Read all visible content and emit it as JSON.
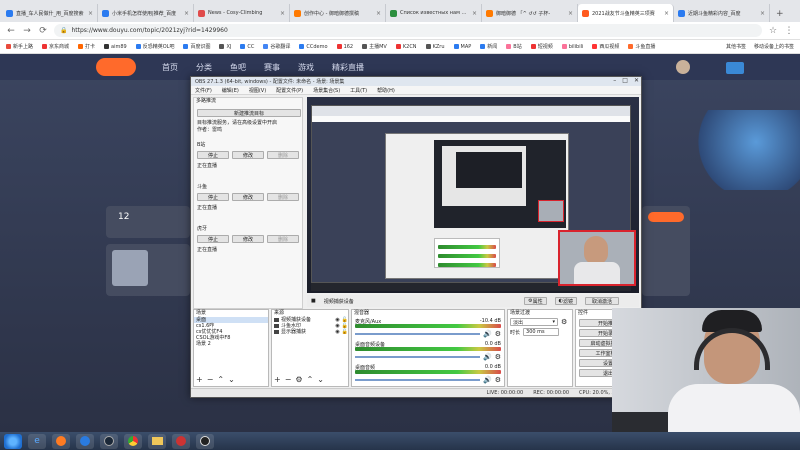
{
  "browser": {
    "tabs": [
      {
        "label": "直播_车人民做什_用_百度搜索",
        "fav": "#2b7bf0"
      },
      {
        "label": "小米手机怎样使用|推荐_百度",
        "fav": "#2b7bf0"
      },
      {
        "label": "News - Cosy-Climbing",
        "fav": "#e04b4b"
      },
      {
        "label": "创作中心 - 御暗御德撰稿",
        "fav": "#ff7a00"
      },
      {
        "label": "Список известных нам карт",
        "fav": "#2c8f3f"
      },
      {
        "label": "御暗御德 「^ ↺↺ 子杯-",
        "fav": "#ff7a00"
      },
      {
        "label": "2021战友节斗鱼精英三项赛",
        "fav": "#ff5a1f",
        "active": true
      },
      {
        "label": "近期斗鱼精彩内容_百度",
        "fav": "#2b7bf0"
      }
    ],
    "url": "https://www.douyu.com/topic/2021zyj?rid=1429960",
    "bookmarks": [
      "新手上路",
      "京东商城",
      "打卡",
      "aim89",
      "反恐精英OL吧",
      "百度识图",
      "XJ",
      "CC",
      "谷歌翻译",
      "CCdemo",
      "162",
      "主播MV",
      "K2CN",
      "KZru",
      "MAP",
      "新闻",
      "B站",
      "短视频",
      "bilibili",
      "西瓜视频",
      "斗鱼直播"
    ],
    "bookmarks_right": [
      "其他书签",
      "移动设备上的书签"
    ]
  },
  "douyu": {
    "nav": [
      "首页",
      "分类",
      "鱼吧",
      "赛事",
      "游戏",
      "精彩直播"
    ],
    "side_number": "12"
  },
  "obs": {
    "title": "OBS 27.1.3 (64-bit, windows) - 配置文件: 未命名 - 场景: 场景集",
    "menu": [
      "文件(F)",
      "编辑(E)",
      "视图(V)",
      "配置文件(P)",
      "场景集合(S)",
      "工具(T)",
      "帮助(H)"
    ],
    "multiview": {
      "title": "多路推流",
      "new_button": "新建推流目标",
      "hint": "目标推流服务，请在高级设置中开启",
      "author_label": "作者：",
      "author": "雷鸣",
      "groups": [
        {
          "name": "B站",
          "start": "停止",
          "edit": "修改",
          "delete": "删除",
          "status": "正在直播"
        },
        {
          "name": "斗鱼",
          "start": "停止",
          "edit": "修改",
          "delete": "删除",
          "status": "正在直播"
        },
        {
          "name": "虎牙",
          "start": "停止",
          "edit": "修改",
          "delete": "删除",
          "status": "正在直播"
        }
      ]
    },
    "preview_bar": {
      "device_label": "视频捕获设备",
      "props": "属性",
      "filters": "滤镜",
      "deactivate": "取消激活"
    },
    "scenes": {
      "title": "场景",
      "items": [
        "桌面",
        "cs1.6咋",
        "cs优优优F4",
        "CSOL游戏中F8",
        "场景 2"
      ]
    },
    "sources": {
      "title": "来源",
      "items": [
        "视频捕获设备",
        "斗鱼水印",
        "显示器捕获"
      ]
    },
    "mixer": {
      "title": "混音器",
      "tracks": [
        {
          "name": "麦克风/Aux",
          "db": "-10.4 dB"
        },
        {
          "name": "桌面音频设备",
          "db": "0.0 dB"
        },
        {
          "name": "桌面音频",
          "db": "0.0 dB"
        }
      ]
    },
    "transitions": {
      "title": "场景过渡",
      "selected": "淡出",
      "duration_label": "时长",
      "duration": "300 ms"
    },
    "controls": {
      "title": "控件",
      "buttons": [
        "开始推流",
        "开始录制",
        "启动虚拟摄像机",
        "工作室模式",
        "设置",
        "退出"
      ]
    },
    "status": {
      "live": "LIVE: 00:00:00",
      "rec": "REC: 00:00:00",
      "cpu": "CPU: 20.0%, 30.00 fps"
    }
  },
  "colors": {
    "accent": "#ff6a2b",
    "webcam_border": "#d9232d",
    "obs_bg": "#efefef"
  }
}
